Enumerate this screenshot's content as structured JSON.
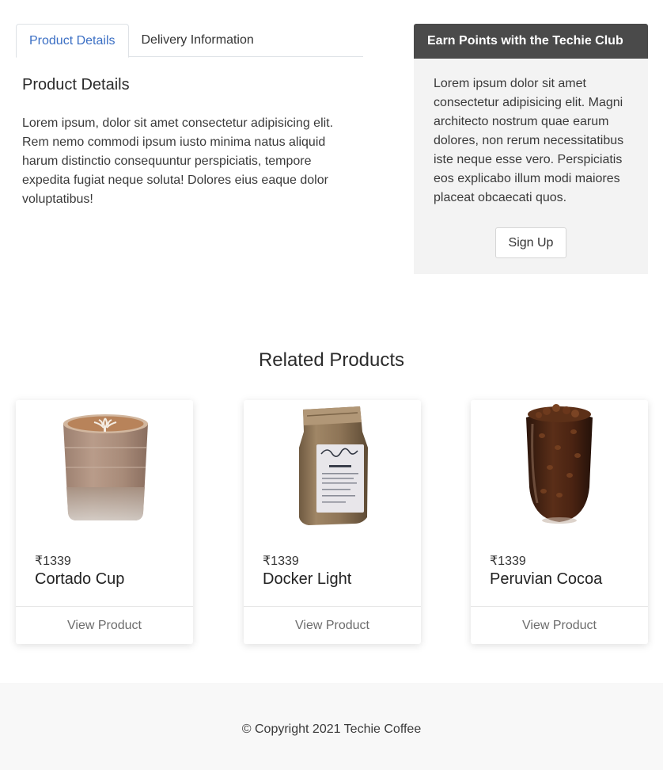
{
  "tabs": [
    {
      "label": "Product Details",
      "active": true
    },
    {
      "label": "Delivery Information",
      "active": false
    }
  ],
  "details": {
    "heading": "Product Details",
    "text": "Lorem ipsum, dolor sit amet consectetur adipisicing elit. Rem nemo commodi ipsum iusto minima natus aliquid harum distinctio consequuntur perspiciatis, tempore expedita fugiat neque soluta! Dolores eius eaque dolor voluptatibus!"
  },
  "club": {
    "title": "Earn Points with the Techie Club",
    "text": "Lorem ipsum dolor sit amet consectetur adipisicing elit. Magni architecto nostrum quae earum dolores, non rerum necessitatibus iste neque esse vero. Perspiciatis eos explicabo illum modi maiores placeat obcaecati quos.",
    "button": "Sign Up"
  },
  "related": {
    "title": "Related Products",
    "products": [
      {
        "price": "₹1339",
        "name": "Cortado Cup",
        "action": "View Product",
        "image": "cortado-glass-image"
      },
      {
        "price": "₹1339",
        "name": "Docker Light",
        "action": "View Product",
        "image": "coffee-bag-image"
      },
      {
        "price": "₹1339",
        "name": "Peruvian Cocoa",
        "action": "View Product",
        "image": "coffee-beans-glass-image"
      }
    ]
  },
  "footer": {
    "copyright": "© Copyright 2021 Techie Coffee"
  },
  "colors": {
    "active_tab": "#3b6fc4",
    "club_header": "#4a4a4a",
    "club_body": "#f3f3f3",
    "footer_bg": "#f8f8f8"
  }
}
